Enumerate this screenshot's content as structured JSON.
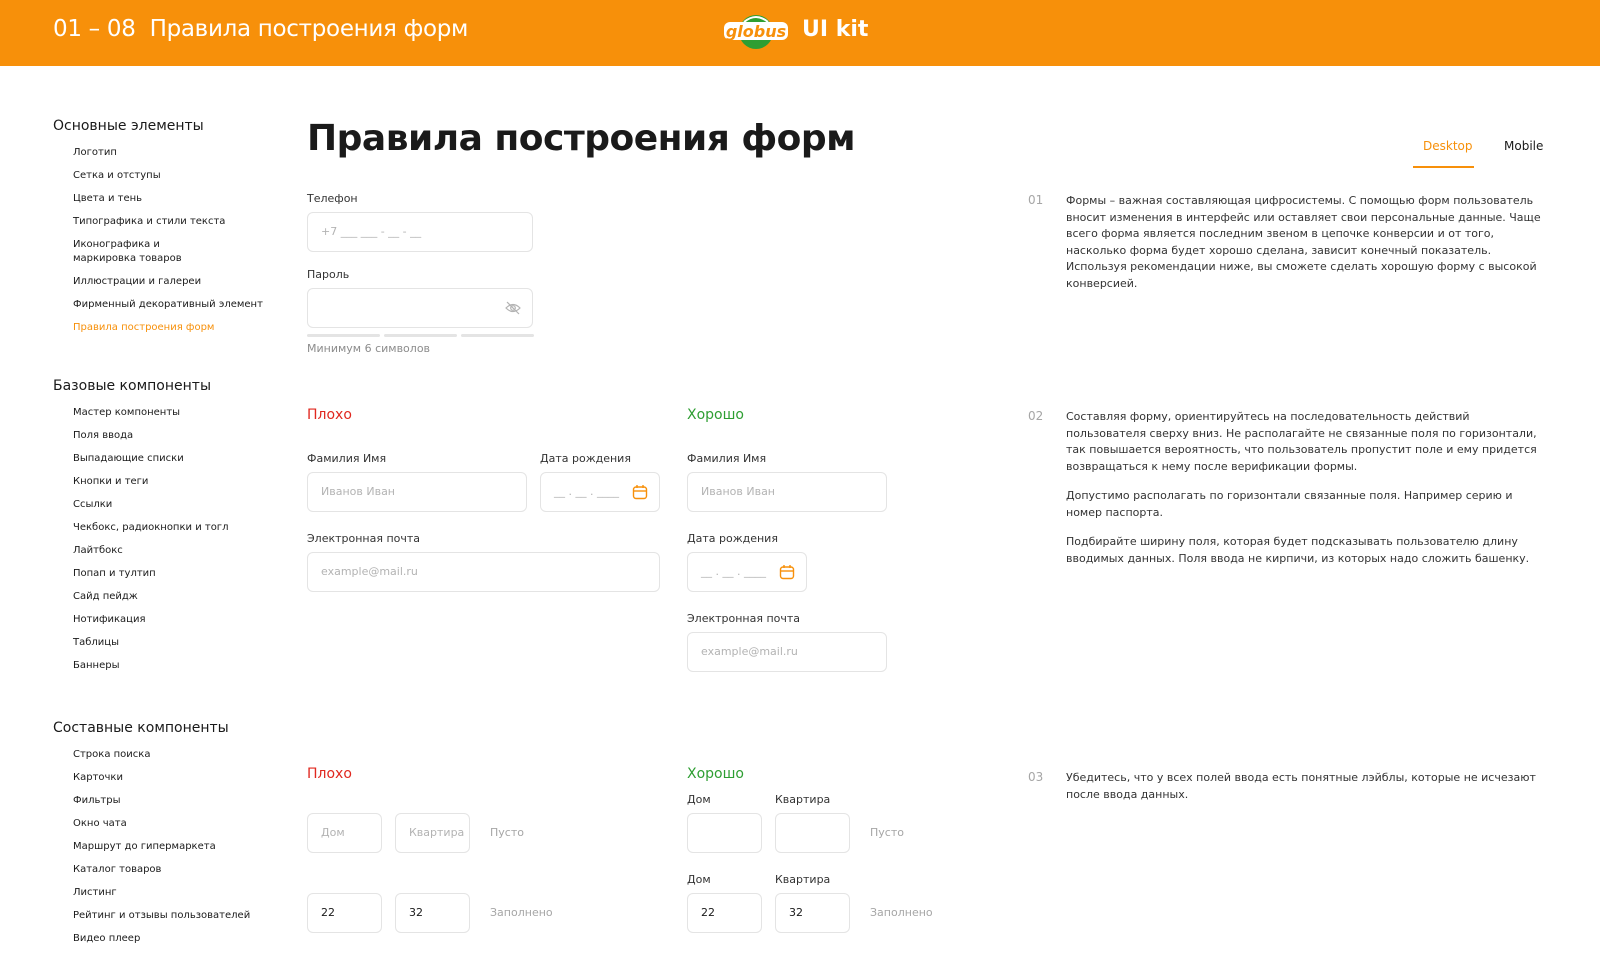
{
  "header": {
    "section_number": "01 – 08",
    "title": "Правила построения форм",
    "brand": "globus",
    "kit_label": "UI kit",
    "bg_color": "#f7900a"
  },
  "sidebar": {
    "sections": [
      {
        "heading": "Основные элементы",
        "items": [
          "Логотип",
          "Сетка и отступы",
          "Цвета и тень",
          "Типографика и стили текста",
          "Иконографика и маркировка товаров",
          "Иллюстрации и галереи",
          "Фирменный декоративный элемент",
          "Правила построения форм"
        ]
      },
      {
        "heading": "Базовые компоненты",
        "items": [
          "Мастер компоненты",
          "Поля ввода",
          "Выпадающие списки",
          "Кнопки и теги",
          "Ссылки",
          "Чекбокс, радиокнопки и тогл",
          "Лайтбокс",
          "Попап и тултип",
          "Сайд пейдж",
          "Нотификация",
          "Таблицы",
          "Баннеры"
        ]
      },
      {
        "heading": "Составные компоненты",
        "items": [
          "Строка поиска",
          "Карточки",
          "Фильтры",
          "Окно чата",
          "Маршрут до гипермаркета",
          "Каталог товаров",
          "Листинг",
          "Рейтинг и отзывы пользователей",
          "Видео плеер"
        ]
      }
    ],
    "active_item": "Правила построения форм"
  },
  "page": {
    "title": "Правила построения форм",
    "tabs": [
      "Desktop",
      "Mobile"
    ],
    "active_tab": "Desktop"
  },
  "example1": {
    "phone_label": "Телефон",
    "phone_placeholder": "+7  ___  ___ - __ - __",
    "password_label": "Пароль",
    "password_hint": "Минимум 6 символов",
    "eye_icon": "eye-off-icon"
  },
  "example2": {
    "bad_label": "Плохо",
    "good_label": "Хорошо",
    "name_label": "Фамилия Имя",
    "name_placeholder": "Иванов Иван",
    "birth_label": "Дата рождения",
    "birth_placeholder": "__ . __ . ____",
    "email_label": "Электронная почта",
    "email_placeholder": "example@mail.ru",
    "calendar_icon": "calendar-icon"
  },
  "example3": {
    "bad_label": "Плохо",
    "good_label": "Хорошо",
    "house_label": "Дом",
    "flat_label": "Квартира",
    "house_placeholder": "Дом",
    "flat_placeholder": "Квартира",
    "empty_state": "Пусто",
    "filled_state": "Заполнено",
    "house_value": "22",
    "flat_value": "32"
  },
  "notes": [
    {
      "number": "01",
      "paragraphs": [
        "Формы – важная составляющая цифросистемы. С помощью форм пользователь вносит изменения в интерфейс или оставляет свои персональные данные. Чаще всего форма является последним звеном в цепочке конверсии и от того, насколько форма будет хорошо сделана, зависит конечный показатель. Используя рекомендации ниже, вы сможете сделать хорошую форму с высокой конверсией."
      ]
    },
    {
      "number": "02",
      "paragraphs": [
        "Составляя форму, ориентируйтесь на последовательность действий пользователя сверху вниз. Не располагайте не связанные поля по горизонтали, так повышается вероятность, что пользователь пропустит поле и ему придется возвращаться к нему после верификации формы.",
        "Допустимо располагать по горизонтали связанные поля. Например серию и номер паспорта.",
        "Подбирайте ширину поля, которая будет подсказывать пользователю длину вводимых данных. Поля ввода не кирпичи, из которых надо сложить башенку."
      ]
    },
    {
      "number": "03",
      "paragraphs": [
        "Убедитесь, что у всех полей ввода есть понятные лэйблы, которые не исчезают после ввода данных."
      ]
    }
  ],
  "colors": {
    "accent": "#f7900a",
    "bad": "#e0281f",
    "good": "#2e9e32",
    "border": "#e4e4e4"
  }
}
